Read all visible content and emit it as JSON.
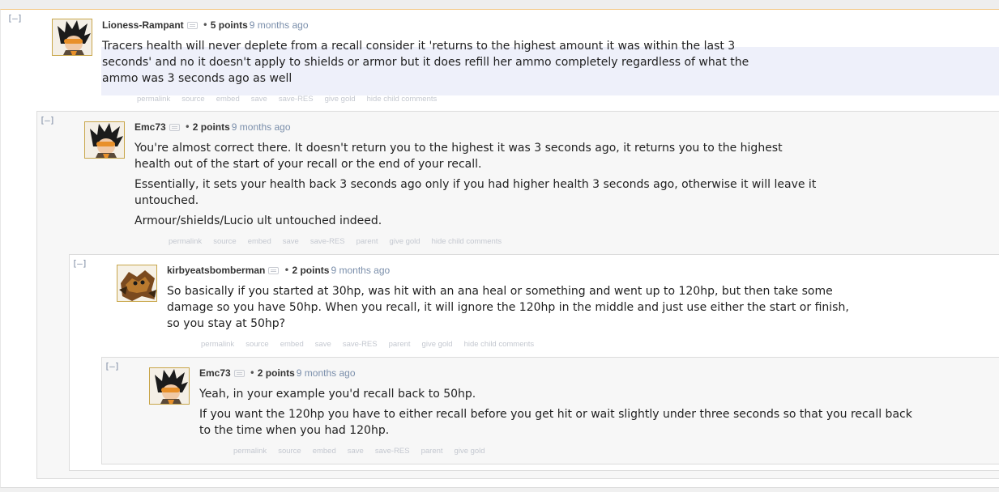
{
  "collapse_label": "[–]",
  "comments": [
    {
      "author": "Lioness-Rampant",
      "points": "5 points",
      "time": "9 months ago",
      "body": [
        "Tracers health will never deplete from a recall consider it 'returns to the highest amount it was within the last 3 seconds' and no it doesn't apply to shields or armor but it does refill her ammo completely regardless of what the ammo was 3 seconds ago as well"
      ],
      "buttons": [
        "permalink",
        "source",
        "embed",
        "save",
        "save-RES",
        "give gold",
        "hide child comments"
      ]
    },
    {
      "author": "Emc73",
      "points": "2 points",
      "time": "9 months ago",
      "body": [
        "You're almost correct there. It doesn't return you to the highest it was 3 seconds ago, it returns you to the highest health out of the start of your recall or the end of your recall.",
        "Essentially, it sets your health back 3 seconds ago only if you had higher health 3 seconds ago, otherwise it will leave it untouched.",
        "Armour/shields/Lucio ult untouched indeed."
      ],
      "buttons": [
        "permalink",
        "source",
        "embed",
        "save",
        "save-RES",
        "parent",
        "give gold",
        "hide child comments"
      ]
    },
    {
      "author": "kirbyeatsbomberman",
      "points": "2 points",
      "time": "9 months ago",
      "body": [
        "So basically if you started at 30hp, was hit with an ana heal or something and went up to 120hp, but then take some damage so you have 50hp. When you recall, it will ignore the 120hp in the middle and just use either the start or finish, so you stay at 50hp?"
      ],
      "buttons": [
        "permalink",
        "source",
        "embed",
        "save",
        "save-RES",
        "parent",
        "give gold",
        "hide child comments"
      ]
    },
    {
      "author": "Emc73",
      "points": "2 points",
      "time": "9 months ago",
      "body": [
        "Yeah, in your example you'd recall back to 50hp.",
        "If you want the 120hp you have to either recall before you get hit or wait slightly under three seconds so that you recall back to the time when you had 120hp."
      ],
      "buttons": [
        "permalink",
        "source",
        "embed",
        "save",
        "save-RES",
        "parent",
        "give gold"
      ]
    }
  ]
}
